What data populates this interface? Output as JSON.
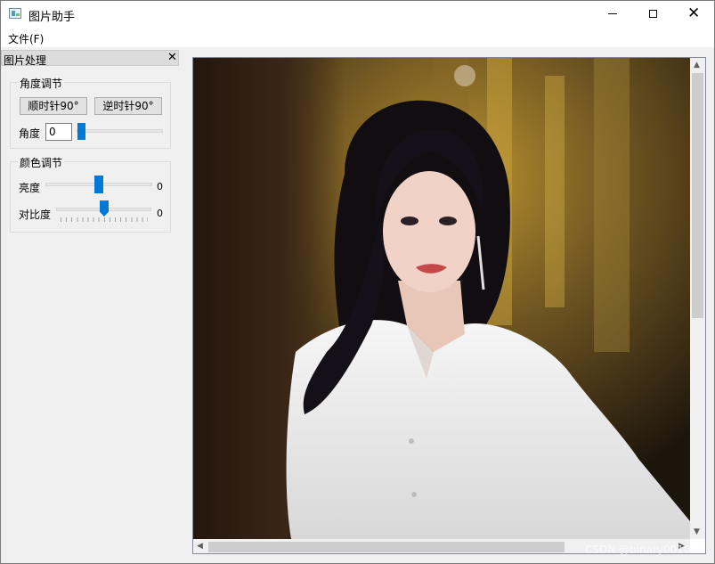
{
  "window": {
    "title": "图片助手",
    "minimize_icon": "minimize-icon",
    "maximize_icon": "maximize-icon",
    "close_icon": "close-icon"
  },
  "menubar": {
    "file_label": "文件(F)"
  },
  "dock": {
    "title": "图片处理",
    "close_glyph": "✕",
    "angle_group": {
      "title": "角度调节",
      "rotate_cw_label": "顺时针90°",
      "rotate_ccw_label": "逆时针90°",
      "angle_label": "角度",
      "angle_value": "0",
      "angle_slider_level": 0
    },
    "color_group": {
      "title": "颜色调节",
      "brightness_label": "亮度",
      "brightness_value": "0",
      "contrast_label": "对比度",
      "contrast_value": "0"
    }
  },
  "image_view": {
    "image_description_icon": "portrait-photo",
    "scroll_up": "▲",
    "scroll_down": "▼",
    "scroll_left": "◀",
    "scroll_right": "▶"
  },
  "watermark": "CSDN @binary0010",
  "colors": {
    "accent": "#0078d7",
    "window_bg": "#f0f0f0"
  }
}
